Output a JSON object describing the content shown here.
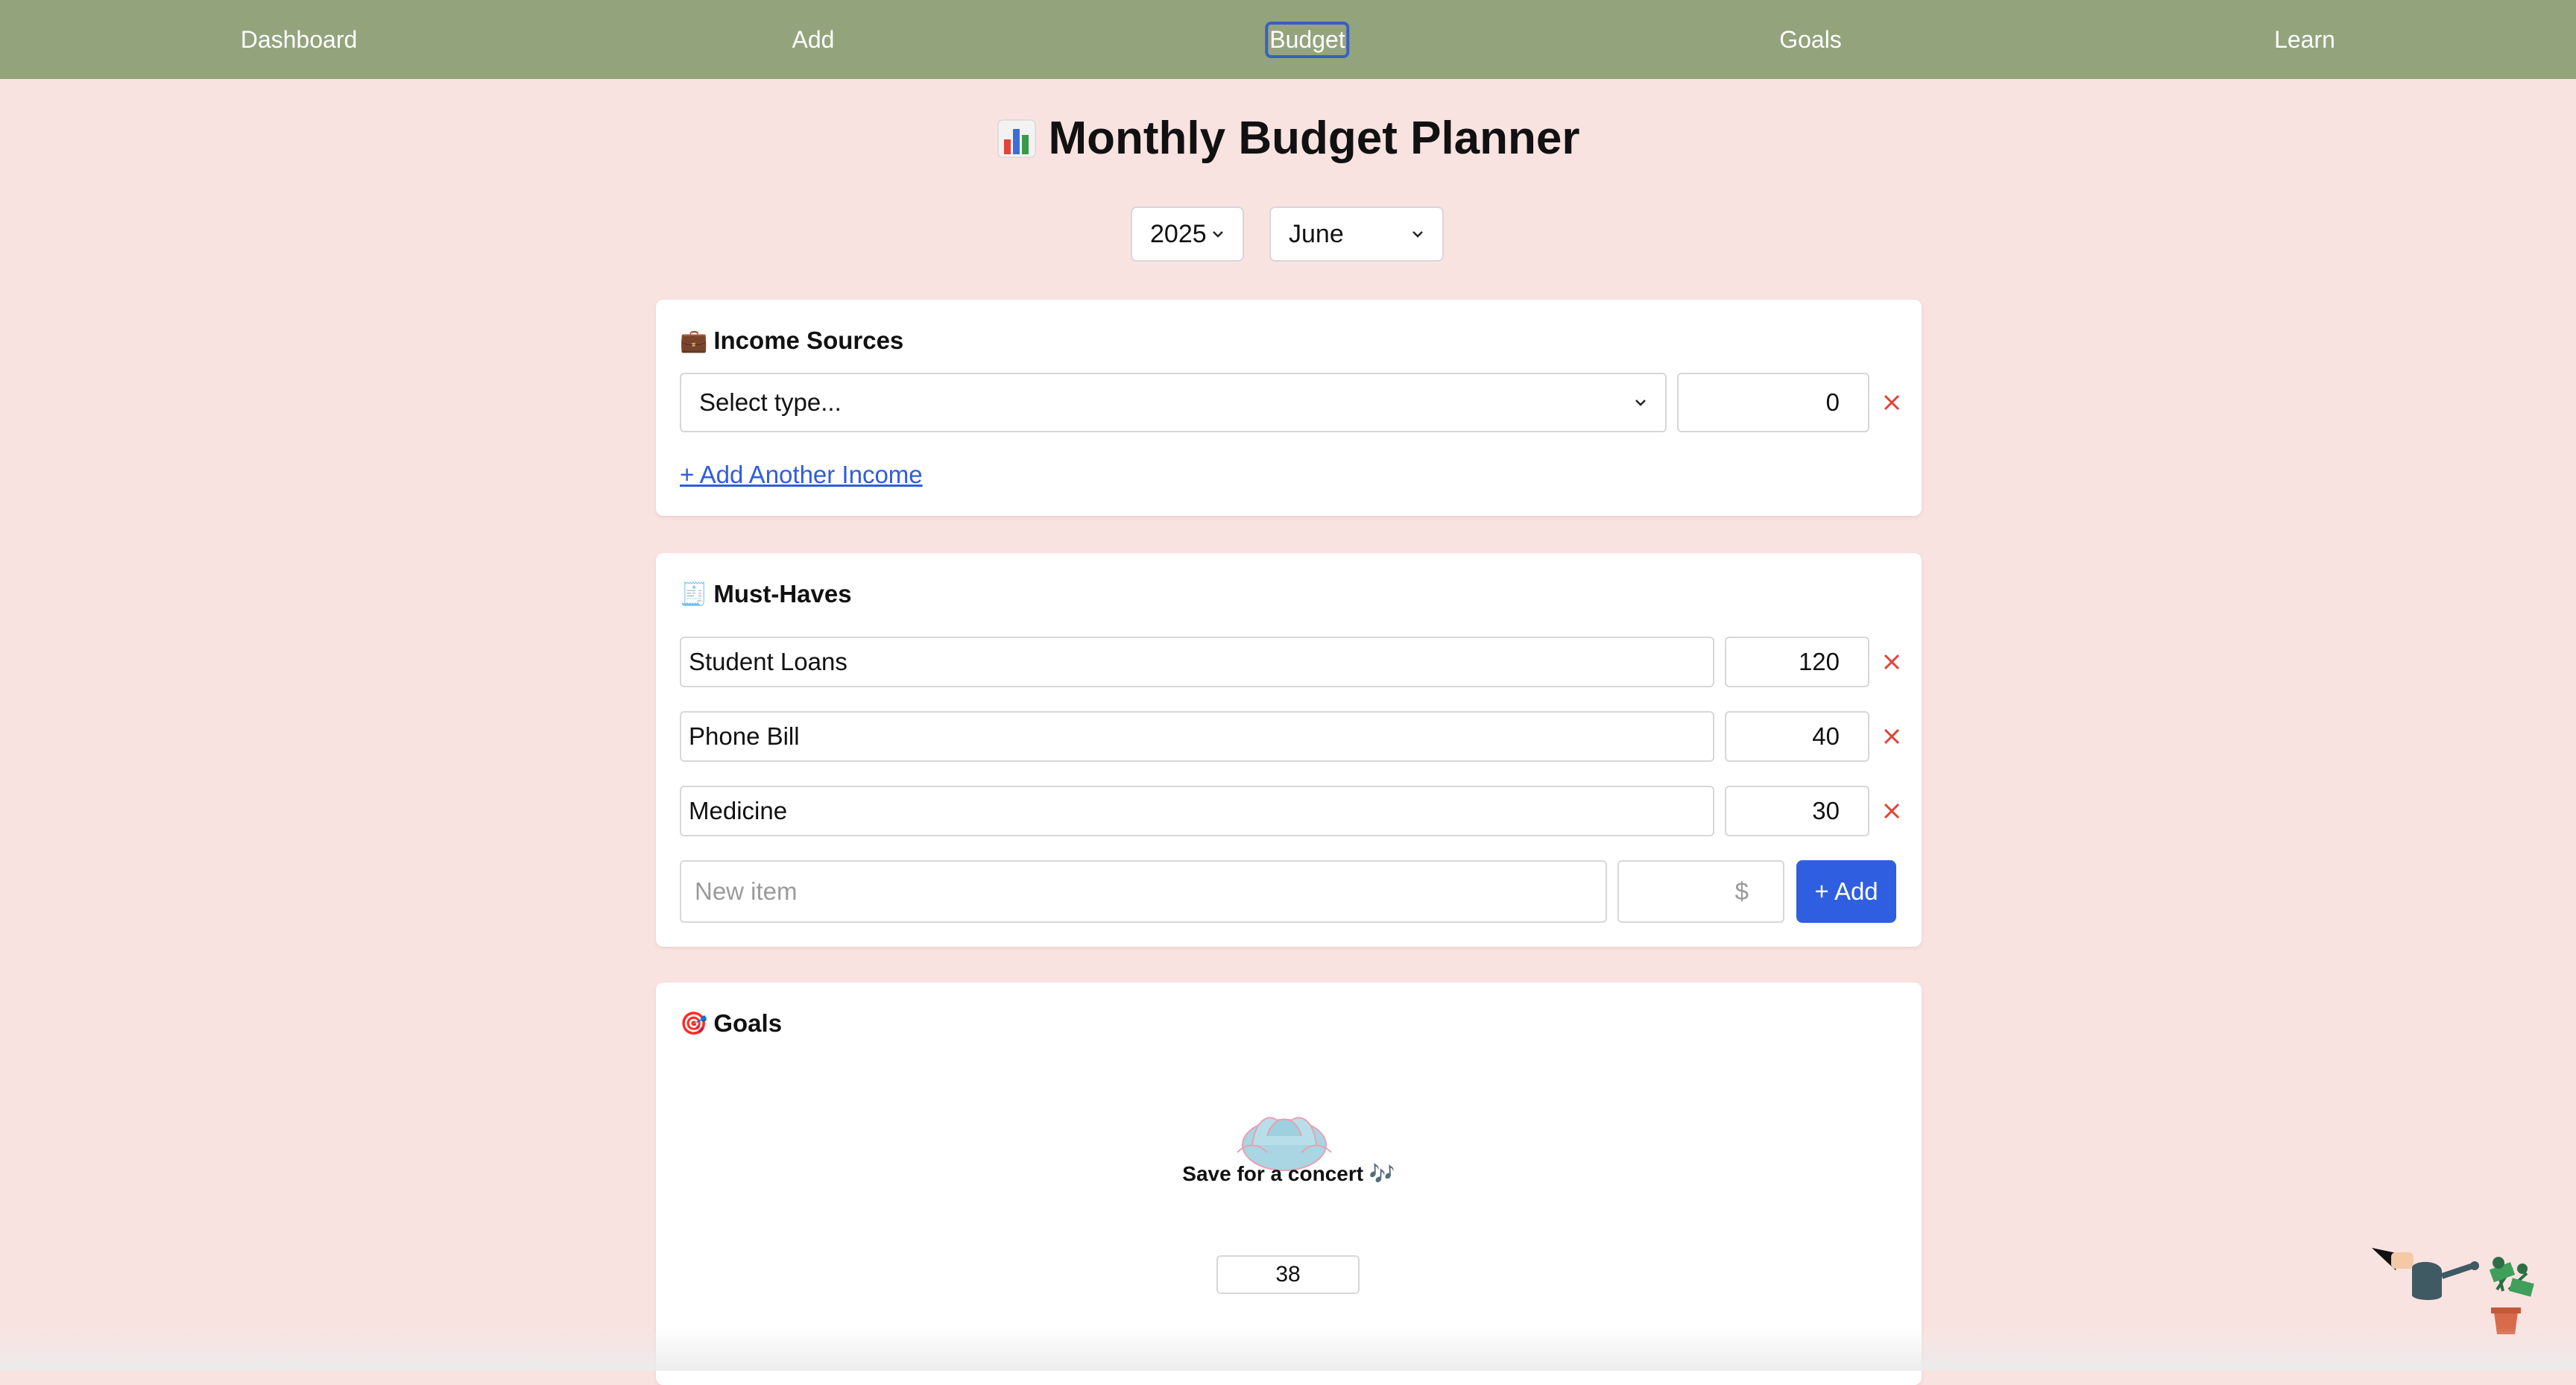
{
  "nav": {
    "items": [
      {
        "label": "Dashboard"
      },
      {
        "label": "Add"
      },
      {
        "label": "Budget"
      },
      {
        "label": "Goals"
      },
      {
        "label": "Learn"
      }
    ],
    "active": "Budget"
  },
  "page": {
    "title": "Monthly Budget Planner",
    "title_icon": "bar-chart-icon"
  },
  "filters": {
    "year": "2025",
    "month": "June"
  },
  "income": {
    "title": "Income Sources",
    "title_icon": "briefcase-icon",
    "rows": [
      {
        "type": "Select type...",
        "amount": "0"
      }
    ],
    "add_label": "+ Add Another Income"
  },
  "must_haves": {
    "title": "Must-Haves",
    "title_icon": "receipt-icon",
    "items": [
      {
        "name": "Student Loans",
        "amount": "120"
      },
      {
        "name": "Phone Bill",
        "amount": "40"
      },
      {
        "name": "Medicine",
        "amount": "30"
      }
    ],
    "new_item_placeholder": "New item",
    "new_amount_placeholder": "$",
    "add_button": "+ Add"
  },
  "goals": {
    "title": "Goals",
    "title_icon": "target-icon",
    "goal_name": "Save for a concert 🎶",
    "goal_value": "38"
  },
  "colors": {
    "nav_bg": "#93a37c",
    "page_bg": "#f9e3e1",
    "accent": "#2f5fe0",
    "remove": "#e0443a"
  }
}
